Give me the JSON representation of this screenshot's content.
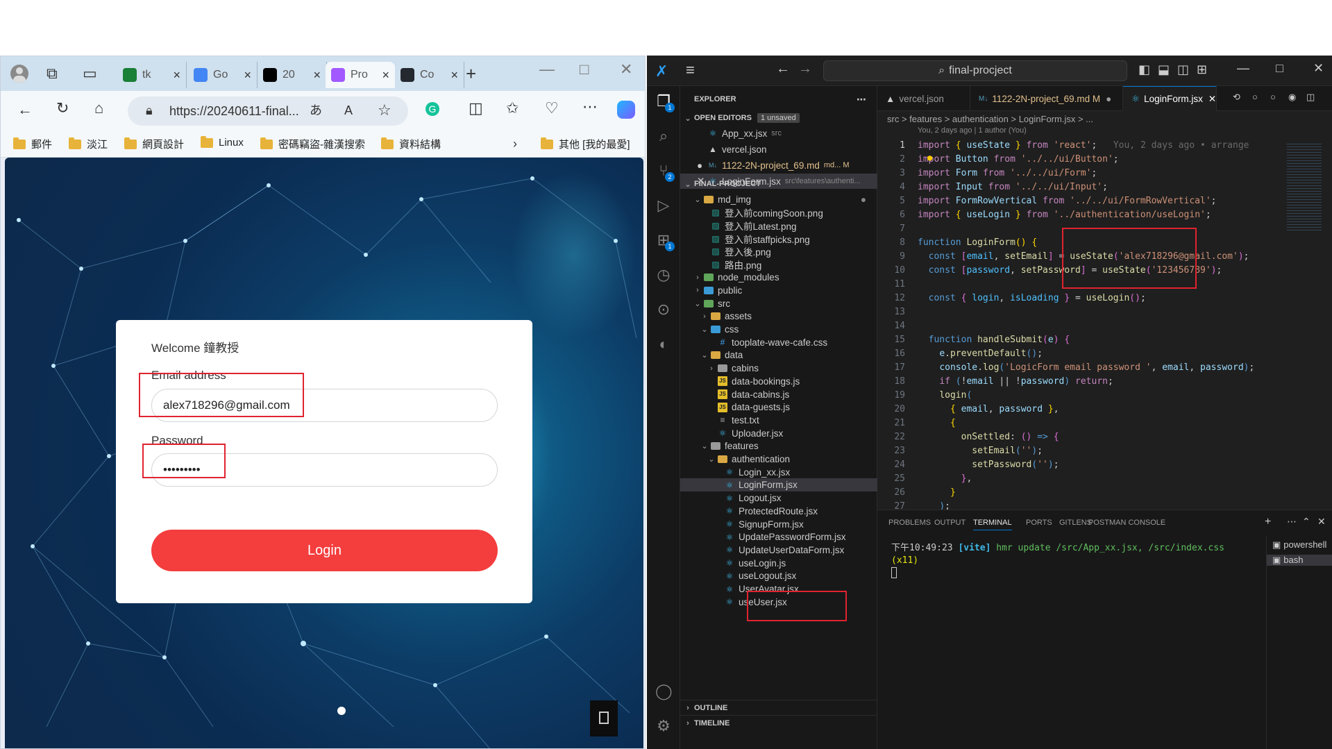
{
  "browser": {
    "tabs": [
      {
        "label": "tk",
        "color": "#1a7f37"
      },
      {
        "label": "Go",
        "color": "#4285f4"
      },
      {
        "label": "20",
        "color": "#000000"
      },
      {
        "label": "Pro",
        "color": "#a259ff"
      },
      {
        "label": "Co",
        "color": "#24292f"
      }
    ],
    "url": "https://20240611-final...",
    "bookmarks": [
      "郵件",
      "淡江",
      "網頁設計",
      "Linux",
      "密碼竊盜-雜漢搜索",
      "資料結構"
    ],
    "other_bookmarks": "其他 [我的最愛]"
  },
  "login": {
    "welcome": "Welcome 鐘教授",
    "email_label": "Email address",
    "email_value": "alex718296@gmail.com",
    "password_label": "Password",
    "password_value": "•••••••••",
    "button": "Login"
  },
  "vscode": {
    "title": "final-procject",
    "explorer_label": "EXPLORER",
    "open_editors": "OPEN EDITORS",
    "unsaved_badge": "1 unsaved",
    "open_files": [
      {
        "name": "App_xx.jsx",
        "hint": "src",
        "icon": "react"
      },
      {
        "name": "vercel.json",
        "hint": "",
        "icon": "vercel"
      },
      {
        "name": "1122-2N-project_69.md",
        "hint": "md... M",
        "icon": "md"
      },
      {
        "name": "LoginForm.jsx",
        "hint": "src\\features\\authenti...",
        "icon": "react"
      }
    ],
    "project": "FINAL-PROCJECT",
    "tree": [
      {
        "name": "md_img",
        "type": "folder-open",
        "depth": 1
      },
      {
        "name": "登入前comingSoon.png",
        "type": "img",
        "depth": 2
      },
      {
        "name": "登入前Latest.png",
        "type": "img",
        "depth": 2
      },
      {
        "name": "登入前staffpicks.png",
        "type": "img",
        "depth": 2
      },
      {
        "name": "登入後.png",
        "type": "img",
        "depth": 2
      },
      {
        "name": "路由.png",
        "type": "img",
        "depth": 2
      },
      {
        "name": "node_modules",
        "type": "folder-green",
        "depth": 1
      },
      {
        "name": "public",
        "type": "folder-blue",
        "depth": 1
      },
      {
        "name": "src",
        "type": "folder-green-open",
        "depth": 1
      },
      {
        "name": "assets",
        "type": "folder",
        "depth": 2
      },
      {
        "name": "css",
        "type": "folder-blue-open",
        "depth": 2
      },
      {
        "name": "tooplate-wave-cafe.css",
        "type": "css",
        "depth": 3
      },
      {
        "name": "data",
        "type": "folder-open",
        "depth": 2
      },
      {
        "name": "cabins",
        "type": "folder-gray",
        "depth": 3
      },
      {
        "name": "data-bookings.js",
        "type": "js",
        "depth": 3
      },
      {
        "name": "data-cabins.js",
        "type": "js",
        "depth": 3
      },
      {
        "name": "data-guests.js",
        "type": "js",
        "depth": 3
      },
      {
        "name": "test.txt",
        "type": "txt",
        "depth": 3
      },
      {
        "name": "Uploader.jsx",
        "type": "react",
        "depth": 3
      },
      {
        "name": "features",
        "type": "folder-gray-open",
        "depth": 2
      },
      {
        "name": "authentication",
        "type": "folder-open",
        "depth": 3
      },
      {
        "name": "Login_xx.jsx",
        "type": "react",
        "depth": 4
      },
      {
        "name": "LoginForm.jsx",
        "type": "react",
        "depth": 4
      },
      {
        "name": "Logout.jsx",
        "type": "react",
        "depth": 4
      },
      {
        "name": "ProtectedRoute.jsx",
        "type": "react",
        "depth": 4
      },
      {
        "name": "SignupForm.jsx",
        "type": "react",
        "depth": 4
      },
      {
        "name": "UpdatePasswordForm.jsx",
        "type": "react",
        "depth": 4
      },
      {
        "name": "UpdateUserDataForm.jsx",
        "type": "react",
        "depth": 4
      },
      {
        "name": "useLogin.js",
        "type": "react",
        "depth": 4
      },
      {
        "name": "useLogout.jsx",
        "type": "react",
        "depth": 4
      },
      {
        "name": "UserAvatar.jsx",
        "type": "react",
        "depth": 4
      },
      {
        "name": "useUser.jsx",
        "type": "react",
        "depth": 4
      }
    ],
    "outline": "OUTLINE",
    "timeline": "TIMELINE",
    "editor_tabs": [
      {
        "label": "vercel.json"
      },
      {
        "label": "1122-2N-project_69.md M"
      },
      {
        "label": "LoginForm.jsx"
      }
    ],
    "breadcrumb": "src > features > authentication > LoginForm.jsx > ...",
    "blame": "You, 2 days ago | 1 author (You)",
    "inline_blame": "You, 2 days ago • arrange",
    "panel_tabs": [
      "PROBLEMS",
      "OUTPUT",
      "TERMINAL",
      "PORTS",
      "GITLENS",
      "POSTMAN CONSOLE"
    ],
    "terminal_line1_time": "下午10:49:23",
    "terminal_line1_tag": "[vite]",
    "terminal_line1_msg": " hmr update /src/App_xx.jsx, /src/index.css",
    "terminal_line2": "(x11)",
    "terminals": [
      "powershell",
      "bash"
    ]
  }
}
